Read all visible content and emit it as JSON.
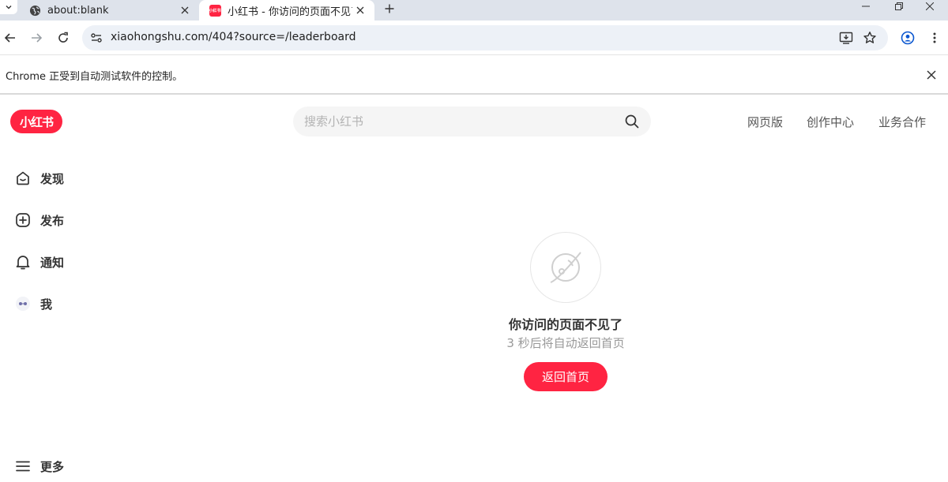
{
  "browser": {
    "tabs": [
      {
        "title": "about:blank",
        "icon": "globe-icon"
      },
      {
        "title": "小红书 - 你访问的页面不见了",
        "icon": "xiaohongshu-favicon",
        "active": true
      }
    ],
    "favicon_text": "小红书",
    "url": "xiaohongshu.com/404?source=/leaderboard",
    "infobar_message": "Chrome 正受到自动测试软件的控制。"
  },
  "header": {
    "logo_text": "小红书",
    "search_placeholder": "搜索小红书",
    "nav": [
      "网页版",
      "创作中心",
      "业务合作"
    ]
  },
  "sidebar": {
    "items": [
      {
        "label": "发现",
        "icon": "home-icon"
      },
      {
        "label": "发布",
        "icon": "plus-square-icon"
      },
      {
        "label": "通知",
        "icon": "bell-icon"
      },
      {
        "label": "我",
        "icon": "avatar-icon"
      }
    ],
    "more_label": "更多"
  },
  "main": {
    "error_title": "你访问的页面不见了",
    "error_subtitle": "3 秒后将自动返回首页",
    "home_button": "返回首页"
  },
  "colors": {
    "brand": "#ff2442",
    "tabstrip": "#dee3eb",
    "omnibox": "#edf1f7"
  }
}
